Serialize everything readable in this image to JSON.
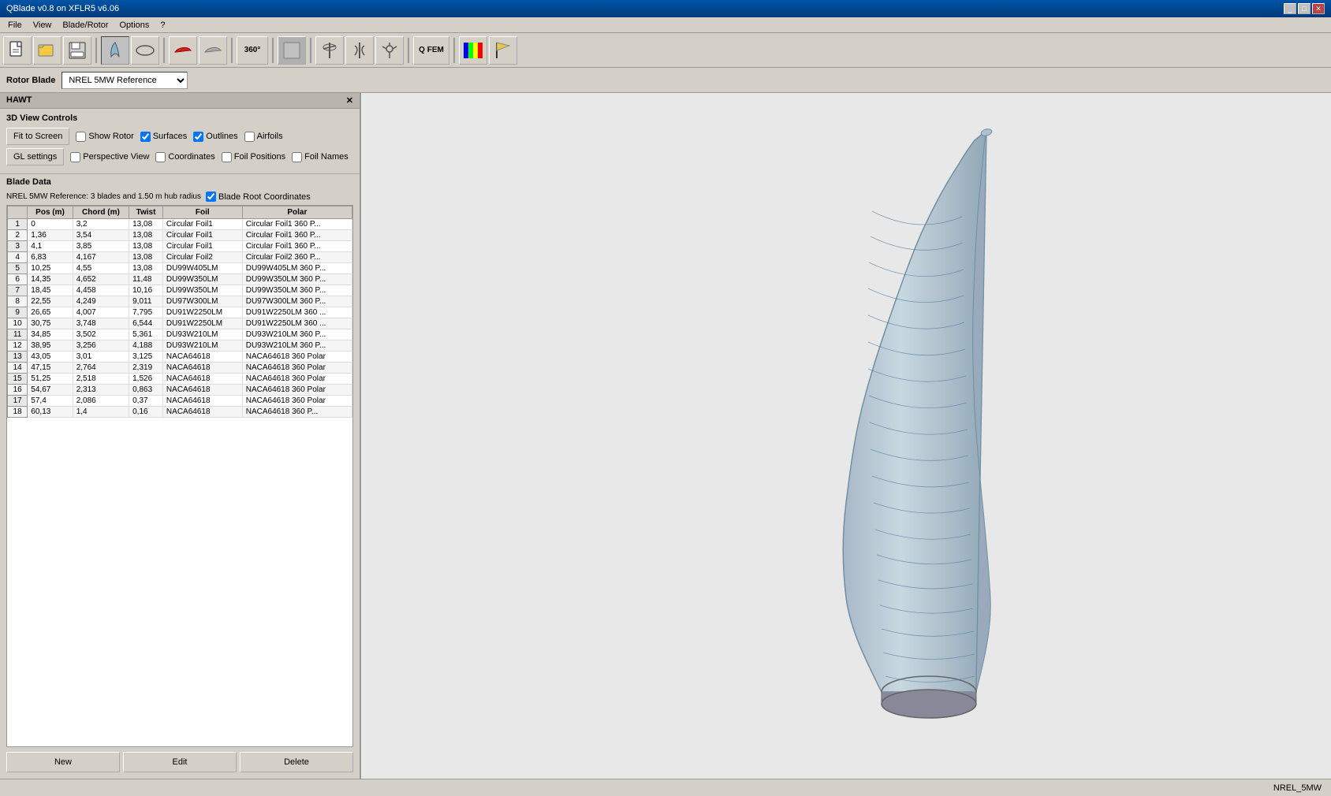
{
  "titleBar": {
    "title": "QBlade v0.8 on XFLR5 v6.06",
    "buttons": [
      "_",
      "□",
      "✕"
    ]
  },
  "menuBar": {
    "items": [
      "File",
      "View",
      "Blade/Rotor",
      "Options",
      "?"
    ]
  },
  "rotorBlade": {
    "label": "Rotor Blade",
    "selectedValue": "NREL 5MW Reference",
    "options": [
      "NREL 5MW Reference"
    ]
  },
  "panelTitle": "HAWT",
  "viewControls": {
    "sectionTitle": "3D View Controls",
    "fitToScreen": "Fit to Screen",
    "showRotor": "Show Rotor",
    "surfaces": "Surfaces",
    "outlines": "Outlines",
    "airfoils": "Airfoils",
    "glSettings": "GL settings",
    "perspectiveView": "Perspective View",
    "coordinates": "Coordinates",
    "foilPositions": "Foil Positions",
    "foilNames": "Foil Names",
    "surfacesChecked": true,
    "outlinesChecked": true,
    "airfoilsChecked": false,
    "perspectiveChecked": false,
    "coordinatesChecked": false,
    "foilPositionsChecked": false,
    "foilNamesChecked": false,
    "showRotorChecked": false
  },
  "bladeData": {
    "sectionTitle": "Blade Data",
    "infoText": "NREL 5MW Reference: 3 blades and 1.50 m hub radius",
    "bladeRootCoords": "Blade Root Coordinates",
    "bladeRootChecked": true,
    "columns": [
      "Pos (m)",
      "Chord (m)",
      "Twist",
      "Foil",
      "Polar"
    ],
    "rows": [
      {
        "num": 1,
        "pos": "0",
        "chord": "3,2",
        "twist": "13,08",
        "foil": "Circular Foil1",
        "polar": "Circular Foil1 360 P..."
      },
      {
        "num": 2,
        "pos": "1,36",
        "chord": "3,54",
        "twist": "13,08",
        "foil": "Circular Foil1",
        "polar": "Circular Foil1 360 P..."
      },
      {
        "num": 3,
        "pos": "4,1",
        "chord": "3,85",
        "twist": "13,08",
        "foil": "Circular Foil1",
        "polar": "Circular Foil1 360 P..."
      },
      {
        "num": 4,
        "pos": "6,83",
        "chord": "4,167",
        "twist": "13,08",
        "foil": "Circular Foil2",
        "polar": "Circular Foil2 360 P..."
      },
      {
        "num": 5,
        "pos": "10,25",
        "chord": "4,55",
        "twist": "13,08",
        "foil": "DU99W405LM",
        "polar": "DU99W405LM 360 P..."
      },
      {
        "num": 6,
        "pos": "14,35",
        "chord": "4,652",
        "twist": "11,48",
        "foil": "DU99W350LM",
        "polar": "DU99W350LM 360 P..."
      },
      {
        "num": 7,
        "pos": "18,45",
        "chord": "4,458",
        "twist": "10,16",
        "foil": "DU99W350LM",
        "polar": "DU99W350LM 360 P..."
      },
      {
        "num": 8,
        "pos": "22,55",
        "chord": "4,249",
        "twist": "9,011",
        "foil": "DU97W300LM",
        "polar": "DU97W300LM 360 P..."
      },
      {
        "num": 9,
        "pos": "26,65",
        "chord": "4,007",
        "twist": "7,795",
        "foil": "DU91W2250LM",
        "polar": "DU91W2250LM 360 ..."
      },
      {
        "num": 10,
        "pos": "30,75",
        "chord": "3,748",
        "twist": "6,544",
        "foil": "DU91W2250LM",
        "polar": "DU91W2250LM 360 ..."
      },
      {
        "num": 11,
        "pos": "34,85",
        "chord": "3,502",
        "twist": "5,361",
        "foil": "DU93W210LM",
        "polar": "DU93W210LM 360 P..."
      },
      {
        "num": 12,
        "pos": "38,95",
        "chord": "3,256",
        "twist": "4,188",
        "foil": "DU93W210LM",
        "polar": "DU93W210LM 360 P..."
      },
      {
        "num": 13,
        "pos": "43,05",
        "chord": "3,01",
        "twist": "3,125",
        "foil": "NACA64618",
        "polar": "NACA64618 360 Polar"
      },
      {
        "num": 14,
        "pos": "47,15",
        "chord": "2,764",
        "twist": "2,319",
        "foil": "NACA64618",
        "polar": "NACA64618 360 Polar"
      },
      {
        "num": 15,
        "pos": "51,25",
        "chord": "2,518",
        "twist": "1,526",
        "foil": "NACA64618",
        "polar": "NACA64618 360 Polar"
      },
      {
        "num": 16,
        "pos": "54,67",
        "chord": "2,313",
        "twist": "0,863",
        "foil": "NACA64618",
        "polar": "NACA64618 360 Polar"
      },
      {
        "num": 17,
        "pos": "57,4",
        "chord": "2,086",
        "twist": "0,37",
        "foil": "NACA64618",
        "polar": "NACA64618 360 Polar"
      },
      {
        "num": 18,
        "pos": "60,13",
        "chord": "1,4",
        "twist": "0,16",
        "foil": "NACA64618",
        "polar": "NACA64618 360 P..."
      }
    ],
    "buttons": {
      "new": "New",
      "edit": "Edit",
      "delete": "Delete"
    }
  },
  "viewPanel": {
    "title": "NREL 5MW Reference"
  },
  "statusBar": {
    "text": "NREL_5MW"
  }
}
